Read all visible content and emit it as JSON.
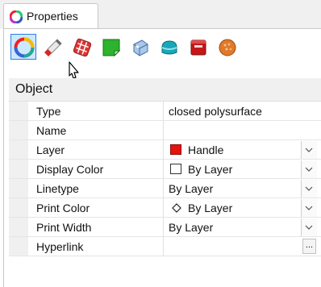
{
  "panel": {
    "tab_label": "Properties"
  },
  "toolbar": {
    "icons": [
      "object-properties-icon",
      "material-icon",
      "texture-mapping-icon",
      "decal-icon",
      "render-mesh-icon",
      "curvature-icon",
      "display-mode-icon",
      "render-icon"
    ]
  },
  "section": {
    "title": "Object"
  },
  "rows": [
    {
      "label": "Type",
      "value": "closed polysurface"
    },
    {
      "label": "Name",
      "value": ""
    },
    {
      "label": "Layer",
      "value": "Handle",
      "swatch": "#e8120c"
    },
    {
      "label": "Display Color",
      "value": "By Layer",
      "swatch": "#ffffff"
    },
    {
      "label": "Linetype",
      "value": "By Layer"
    },
    {
      "label": "Print Color",
      "value": "By Layer"
    },
    {
      "label": "Print Width",
      "value": "By Layer"
    },
    {
      "label": "Hyperlink",
      "value": "",
      "button": "..."
    }
  ],
  "colors": {
    "accent": "#2b7de1",
    "layer_swatch": "#e8120c"
  }
}
